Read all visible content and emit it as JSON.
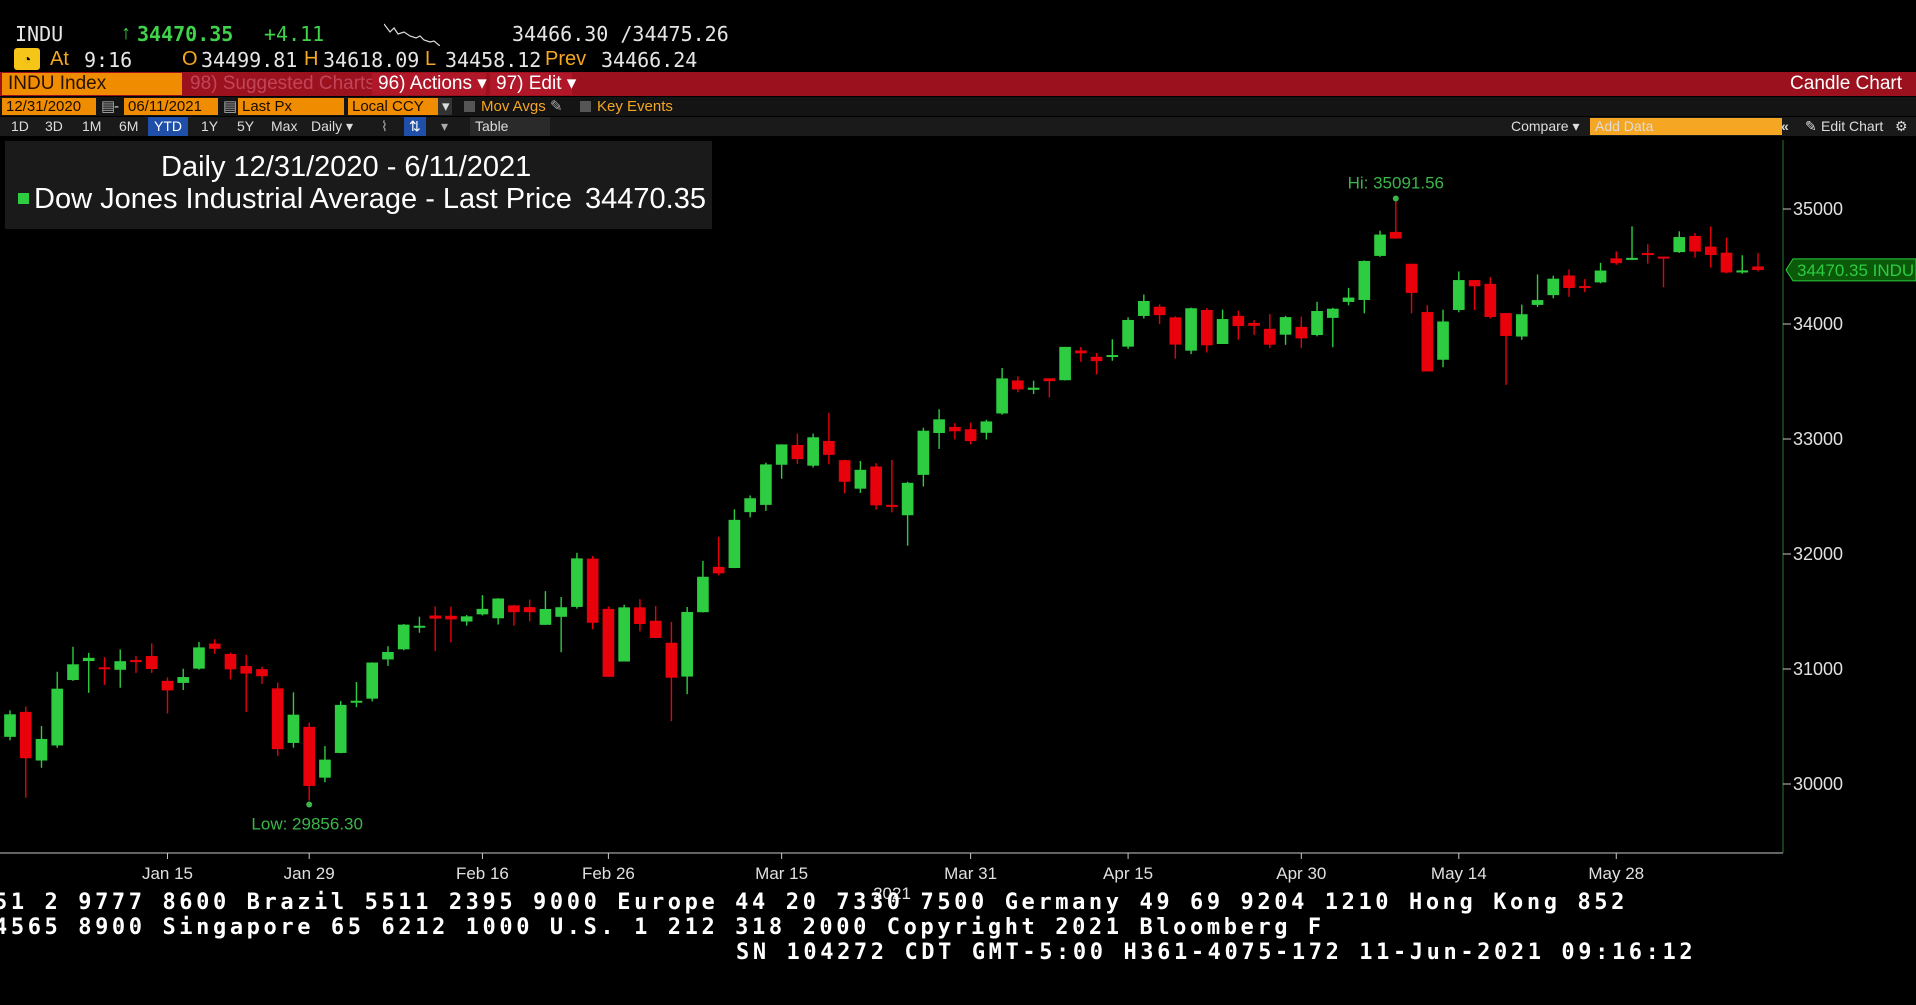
{
  "quote": {
    "symbol": "INDU",
    "arrow": "↑",
    "last": "34470.35",
    "change": "+4.11",
    "bid_ask": "34466.30 /34475.26",
    "time_label": "At",
    "time": "9:16",
    "open_label": "O",
    "open": "34499.81",
    "high_label": "H",
    "high": "34618.09",
    "low_label": "L",
    "low": "34458.12",
    "prev_label": "Prev",
    "prev": "34466.24"
  },
  "toolbar": {
    "security": "INDU Index",
    "suggested": "98) Suggested Charts",
    "actions": "96) Actions ▾",
    "edit": "97) Edit ▾",
    "chart_type": "Candle Chart"
  },
  "controls": {
    "start_date": "12/31/2020",
    "dash": "-",
    "end_date": "06/11/2021",
    "field": "Last Px",
    "currency": "Local CCY",
    "mov_avgs": "Mov Avgs",
    "key_events": "Key Events"
  },
  "periods": {
    "items": [
      "1D",
      "3D",
      "1M",
      "6M",
      "YTD",
      "1Y",
      "5Y",
      "Max"
    ],
    "active": "YTD",
    "frequency": "Daily ▾",
    "table": "Table",
    "compare": "Compare ▾",
    "add_data": "Add Data",
    "collapse": "«",
    "edit_chart": "Edit Chart"
  },
  "legend": {
    "line1": "Daily 12/31/2020 - 6/11/2021",
    "line2": "Dow Jones Industrial Average - Last Price",
    "line2_value": "34470.35"
  },
  "chart_data": {
    "type": "candlestick",
    "title": "Daily 12/31/2020 - 6/11/2021",
    "series": [
      {
        "name": "Dow Jones Industrial Average - Last Price",
        "last": 34470.35
      }
    ],
    "ylim": [
      29400,
      35600
    ],
    "yticks": [
      30000,
      31000,
      32000,
      33000,
      34000,
      35000
    ],
    "xtick_labels": [
      {
        "date": "2021-01-15",
        "label": "Jan 15"
      },
      {
        "date": "2021-01-29",
        "label": "Jan 29"
      },
      {
        "date": "2021-02-16",
        "label": "Feb 16"
      },
      {
        "date": "2021-02-26",
        "label": "Feb 26"
      },
      {
        "date": "2021-03-15",
        "label": "Mar 15"
      },
      {
        "date": "2021-03-31",
        "label": "Mar 31"
      },
      {
        "date": "2021-04-15",
        "label": "Apr 15"
      },
      {
        "date": "2021-04-30",
        "label": "Apr 30"
      },
      {
        "date": "2021-05-14",
        "label": "May 14"
      },
      {
        "date": "2021-05-28",
        "label": "May 28"
      }
    ],
    "year_label": "2021",
    "annotations": {
      "high": {
        "date": "2021-05-10",
        "value": 35091.56,
        "label": "Hi: 35091.56"
      },
      "low": {
        "date": "2021-01-29",
        "value": 29856.3,
        "label": "Low: 29856.30"
      },
      "last": {
        "value": 34470.35,
        "label": "34470.35 INDU"
      }
    },
    "colors": {
      "up": "#2ecc40",
      "down": "#e8000b",
      "axis": "#c8c8c8",
      "label_green": "#3cb54a",
      "last_box": "#0a5a0a"
    },
    "candles": [
      {
        "date": "2020-12-31",
        "open": 30410,
        "high": 30640,
        "low": 30380,
        "close": 30606
      },
      {
        "date": "2021-01-04",
        "open": 30627,
        "high": 30674,
        "low": 29881,
        "close": 30224
      },
      {
        "date": "2021-01-05",
        "open": 30204,
        "high": 30504,
        "low": 30141,
        "close": 30392
      },
      {
        "date": "2021-01-06",
        "open": 30335,
        "high": 30976,
        "low": 30315,
        "close": 30829
      },
      {
        "date": "2021-01-07",
        "open": 30904,
        "high": 31193,
        "low": 30897,
        "close": 31041
      },
      {
        "date": "2021-01-08",
        "open": 31069,
        "high": 31140,
        "low": 30793,
        "close": 31097
      },
      {
        "date": "2021-01-11",
        "open": 31015,
        "high": 31103,
        "low": 30862,
        "close": 31009
      },
      {
        "date": "2021-01-12",
        "open": 30993,
        "high": 31170,
        "low": 30837,
        "close": 31068
      },
      {
        "date": "2021-01-13",
        "open": 31078,
        "high": 31115,
        "low": 30966,
        "close": 31060
      },
      {
        "date": "2021-01-14",
        "open": 31113,
        "high": 31223,
        "low": 30966,
        "close": 31000
      },
      {
        "date": "2021-01-15",
        "open": 30897,
        "high": 30926,
        "low": 30613,
        "close": 30814
      },
      {
        "date": "2021-01-19",
        "open": 30879,
        "high": 31002,
        "low": 30817,
        "close": 30930
      },
      {
        "date": "2021-01-20",
        "open": 31003,
        "high": 31235,
        "low": 30994,
        "close": 31188
      },
      {
        "date": "2021-01-21",
        "open": 31221,
        "high": 31260,
        "low": 31133,
        "close": 31176
      },
      {
        "date": "2021-01-22",
        "open": 31131,
        "high": 31142,
        "low": 30910,
        "close": 30997
      },
      {
        "date": "2021-01-25",
        "open": 31026,
        "high": 31123,
        "low": 30627,
        "close": 30960
      },
      {
        "date": "2021-01-26",
        "open": 30999,
        "high": 31021,
        "low": 30870,
        "close": 30937
      },
      {
        "date": "2021-01-27",
        "open": 30832,
        "high": 30882,
        "low": 30245,
        "close": 30303
      },
      {
        "date": "2021-01-28",
        "open": 30357,
        "high": 30797,
        "low": 30316,
        "close": 30603
      },
      {
        "date": "2021-01-29",
        "open": 30497,
        "high": 30533,
        "low": 29856,
        "close": 29983
      },
      {
        "date": "2021-02-01",
        "open": 30055,
        "high": 30330,
        "low": 30015,
        "close": 30212
      },
      {
        "date": "2021-02-02",
        "open": 30270,
        "high": 30721,
        "low": 30267,
        "close": 30688
      },
      {
        "date": "2021-02-03",
        "open": 30717,
        "high": 30887,
        "low": 30668,
        "close": 30724
      },
      {
        "date": "2021-02-04",
        "open": 30742,
        "high": 31058,
        "low": 30718,
        "close": 31056
      },
      {
        "date": "2021-02-05",
        "open": 31083,
        "high": 31198,
        "low": 31027,
        "close": 31148
      },
      {
        "date": "2021-02-08",
        "open": 31171,
        "high": 31391,
        "low": 31163,
        "close": 31386
      },
      {
        "date": "2021-02-09",
        "open": 31363,
        "high": 31455,
        "low": 31315,
        "close": 31376
      },
      {
        "date": "2021-02-10",
        "open": 31465,
        "high": 31544,
        "low": 31156,
        "close": 31438
      },
      {
        "date": "2021-02-11",
        "open": 31463,
        "high": 31542,
        "low": 31232,
        "close": 31431
      },
      {
        "date": "2021-02-12",
        "open": 31413,
        "high": 31469,
        "low": 31377,
        "close": 31458
      },
      {
        "date": "2021-02-16",
        "open": 31475,
        "high": 31642,
        "low": 31465,
        "close": 31523
      },
      {
        "date": "2021-02-17",
        "open": 31441,
        "high": 31616,
        "low": 31387,
        "close": 31613
      },
      {
        "date": "2021-02-18",
        "open": 31553,
        "high": 31558,
        "low": 31377,
        "close": 31494
      },
      {
        "date": "2021-02-19",
        "open": 31538,
        "high": 31604,
        "low": 31414,
        "close": 31494
      },
      {
        "date": "2021-02-22",
        "open": 31384,
        "high": 31677,
        "low": 31384,
        "close": 31522
      },
      {
        "date": "2021-02-23",
        "open": 31454,
        "high": 31626,
        "low": 31146,
        "close": 31537
      },
      {
        "date": "2021-02-24",
        "open": 31540,
        "high": 32010,
        "low": 31525,
        "close": 31962
      },
      {
        "date": "2021-02-25",
        "open": 31960,
        "high": 31982,
        "low": 31346,
        "close": 31402
      },
      {
        "date": "2021-02-26",
        "open": 31523,
        "high": 31544,
        "low": 30994,
        "close": 30932
      },
      {
        "date": "2021-03-01",
        "open": 31065,
        "high": 31559,
        "low": 31065,
        "close": 31536
      },
      {
        "date": "2021-03-02",
        "open": 31536,
        "high": 31607,
        "low": 31327,
        "close": 31391
      },
      {
        "date": "2021-03-03",
        "open": 31420,
        "high": 31547,
        "low": 31268,
        "close": 31270
      },
      {
        "date": "2021-03-04",
        "open": 31228,
        "high": 31410,
        "low": 30547,
        "close": 30924
      },
      {
        "date": "2021-03-05",
        "open": 30934,
        "high": 31539,
        "low": 30781,
        "close": 31496
      },
      {
        "date": "2021-03-08",
        "open": 31494,
        "high": 31940,
        "low": 31491,
        "close": 31802
      },
      {
        "date": "2021-03-09",
        "open": 31888,
        "high": 32150,
        "low": 31815,
        "close": 31832
      },
      {
        "date": "2021-03-10",
        "open": 31878,
        "high": 32389,
        "low": 31877,
        "close": 32297
      },
      {
        "date": "2021-03-11",
        "open": 32364,
        "high": 32509,
        "low": 32319,
        "close": 32485
      },
      {
        "date": "2021-03-12",
        "open": 32427,
        "high": 32794,
        "low": 32375,
        "close": 32779
      },
      {
        "date": "2021-03-15",
        "open": 32776,
        "high": 32954,
        "low": 32654,
        "close": 32953
      },
      {
        "date": "2021-03-16",
        "open": 32948,
        "high": 33048,
        "low": 32783,
        "close": 32825
      },
      {
        "date": "2021-03-17",
        "open": 32768,
        "high": 33047,
        "low": 32752,
        "close": 33015
      },
      {
        "date": "2021-03-18",
        "open": 32983,
        "high": 33227,
        "low": 32780,
        "close": 32862
      },
      {
        "date": "2021-03-19",
        "open": 32816,
        "high": 32820,
        "low": 32529,
        "close": 32628
      },
      {
        "date": "2021-03-22",
        "open": 32568,
        "high": 32809,
        "low": 32531,
        "close": 32732
      },
      {
        "date": "2021-03-23",
        "open": 32761,
        "high": 32790,
        "low": 32387,
        "close": 32423
      },
      {
        "date": "2021-03-24",
        "open": 32427,
        "high": 32818,
        "low": 32362,
        "close": 32420
      },
      {
        "date": "2021-03-25",
        "open": 32337,
        "high": 32628,
        "low": 32072,
        "close": 32619
      },
      {
        "date": "2021-03-26",
        "open": 32688,
        "high": 33098,
        "low": 32587,
        "close": 33072
      },
      {
        "date": "2021-03-29",
        "open": 33052,
        "high": 33259,
        "low": 32914,
        "close": 33171
      },
      {
        "date": "2021-03-30",
        "open": 33105,
        "high": 33138,
        "low": 32996,
        "close": 33067
      },
      {
        "date": "2021-03-31",
        "open": 33085,
        "high": 33142,
        "low": 32953,
        "close": 32982
      },
      {
        "date": "2021-04-01",
        "open": 33054,
        "high": 33167,
        "low": 32996,
        "close": 33153
      },
      {
        "date": "2021-04-05",
        "open": 33222,
        "high": 33617,
        "low": 33211,
        "close": 33527
      },
      {
        "date": "2021-04-06",
        "open": 33509,
        "high": 33545,
        "low": 33407,
        "close": 33431
      },
      {
        "date": "2021-04-07",
        "open": 33428,
        "high": 33507,
        "low": 33391,
        "close": 33446
      },
      {
        "date": "2021-04-08",
        "open": 33528,
        "high": 33528,
        "low": 33361,
        "close": 33503
      },
      {
        "date": "2021-04-09",
        "open": 33511,
        "high": 33801,
        "low": 33509,
        "close": 33801
      },
      {
        "date": "2021-04-12",
        "open": 33770,
        "high": 33800,
        "low": 33672,
        "close": 33745
      },
      {
        "date": "2021-04-13",
        "open": 33715,
        "high": 33748,
        "low": 33561,
        "close": 33677
      },
      {
        "date": "2021-04-14",
        "open": 33715,
        "high": 33867,
        "low": 33680,
        "close": 33730
      },
      {
        "date": "2021-04-15",
        "open": 33803,
        "high": 34058,
        "low": 33784,
        "close": 34035
      },
      {
        "date": "2021-04-16",
        "open": 34070,
        "high": 34256,
        "low": 34048,
        "close": 34200
      },
      {
        "date": "2021-04-19",
        "open": 34150,
        "high": 34170,
        "low": 34000,
        "close": 34077
      },
      {
        "date": "2021-04-20",
        "open": 34058,
        "high": 34066,
        "low": 33698,
        "close": 33821
      },
      {
        "date": "2021-04-21",
        "open": 33768,
        "high": 34143,
        "low": 33738,
        "close": 34137
      },
      {
        "date": "2021-04-22",
        "open": 34122,
        "high": 34140,
        "low": 33752,
        "close": 33815
      },
      {
        "date": "2021-04-23",
        "open": 33826,
        "high": 34125,
        "low": 33826,
        "close": 34043
      },
      {
        "date": "2021-04-26",
        "open": 34071,
        "high": 34115,
        "low": 33864,
        "close": 33982
      },
      {
        "date": "2021-04-27",
        "open": 34009,
        "high": 34036,
        "low": 33905,
        "close": 33984
      },
      {
        "date": "2021-04-28",
        "open": 33958,
        "high": 34086,
        "low": 33790,
        "close": 33820
      },
      {
        "date": "2021-04-29",
        "open": 33907,
        "high": 34071,
        "low": 33819,
        "close": 34060
      },
      {
        "date": "2021-04-30",
        "open": 33975,
        "high": 34063,
        "low": 33791,
        "close": 33875
      },
      {
        "date": "2021-05-03",
        "open": 33904,
        "high": 34193,
        "low": 33893,
        "close": 34113
      },
      {
        "date": "2021-05-04",
        "open": 34053,
        "high": 34141,
        "low": 33798,
        "close": 34133
      },
      {
        "date": "2021-05-05",
        "open": 34192,
        "high": 34314,
        "low": 34162,
        "close": 34230
      },
      {
        "date": "2021-05-06",
        "open": 34209,
        "high": 34553,
        "low": 34093,
        "close": 34548
      },
      {
        "date": "2021-05-07",
        "open": 34592,
        "high": 34812,
        "low": 34584,
        "close": 34778
      },
      {
        "date": "2021-05-10",
        "open": 34801,
        "high": 35092,
        "low": 34761,
        "close": 34743
      },
      {
        "date": "2021-05-11",
        "open": 34524,
        "high": 34524,
        "low": 34093,
        "close": 34270
      },
      {
        "date": "2021-05-12",
        "open": 34104,
        "high": 34164,
        "low": 33587,
        "close": 33587
      },
      {
        "date": "2021-05-13",
        "open": 33689,
        "high": 34125,
        "low": 33624,
        "close": 34022
      },
      {
        "date": "2021-05-14",
        "open": 34122,
        "high": 34457,
        "low": 34102,
        "close": 34382
      },
      {
        "date": "2021-05-17",
        "open": 34382,
        "high": 34383,
        "low": 34121,
        "close": 34328
      },
      {
        "date": "2021-05-18",
        "open": 34349,
        "high": 34408,
        "low": 34048,
        "close": 34061
      },
      {
        "date": "2021-05-19",
        "open": 34095,
        "high": 34096,
        "low": 33470,
        "close": 33896
      },
      {
        "date": "2021-05-20",
        "open": 33891,
        "high": 34169,
        "low": 33862,
        "close": 34085
      },
      {
        "date": "2021-05-21",
        "open": 34166,
        "high": 34431,
        "low": 34148,
        "close": 34208
      },
      {
        "date": "2021-05-24",
        "open": 34251,
        "high": 34420,
        "low": 34224,
        "close": 34394
      },
      {
        "date": "2021-05-25",
        "open": 34422,
        "high": 34474,
        "low": 34236,
        "close": 34313
      },
      {
        "date": "2021-05-26",
        "open": 34330,
        "high": 34391,
        "low": 34277,
        "close": 34323
      },
      {
        "date": "2021-05-27",
        "open": 34362,
        "high": 34532,
        "low": 34354,
        "close": 34465
      },
      {
        "date": "2021-05-28",
        "open": 34571,
        "high": 34631,
        "low": 34515,
        "close": 34529
      },
      {
        "date": "2021-06-01",
        "open": 34558,
        "high": 34849,
        "low": 34555,
        "close": 34575
      },
      {
        "date": "2021-06-02",
        "open": 34617,
        "high": 34694,
        "low": 34525,
        "close": 34600
      },
      {
        "date": "2021-06-03",
        "open": 34586,
        "high": 34586,
        "low": 34319,
        "close": 34577
      },
      {
        "date": "2021-06-04",
        "open": 34625,
        "high": 34806,
        "low": 34618,
        "close": 34756
      },
      {
        "date": "2021-06-07",
        "open": 34766,
        "high": 34792,
        "low": 34577,
        "close": 34630
      },
      {
        "date": "2021-06-08",
        "open": 34673,
        "high": 34849,
        "low": 34490,
        "close": 34600
      },
      {
        "date": "2021-06-09",
        "open": 34620,
        "high": 34751,
        "low": 34440,
        "close": 34448
      },
      {
        "date": "2021-06-10",
        "open": 34448,
        "high": 34598,
        "low": 34437,
        "close": 34466
      },
      {
        "date": "2021-06-11",
        "open": 34500,
        "high": 34618,
        "low": 34458,
        "close": 34470
      }
    ]
  },
  "tape": {
    "line1": "51 2 9777 8600 Brazil 5511 2395 9000 Europe 44 20 7330 7500 Germany 49 69 9204 1210 Hong Kong 852",
    "line2": " 4565 8900       Singapore 65 6212 1000       U.S. 1 212 318 2000        Copyright 2021 Bloomberg F",
    "line3": "SN 104272 CDT  GMT-5:00 H361-4075-172 11-Jun-2021 09:16:12"
  }
}
